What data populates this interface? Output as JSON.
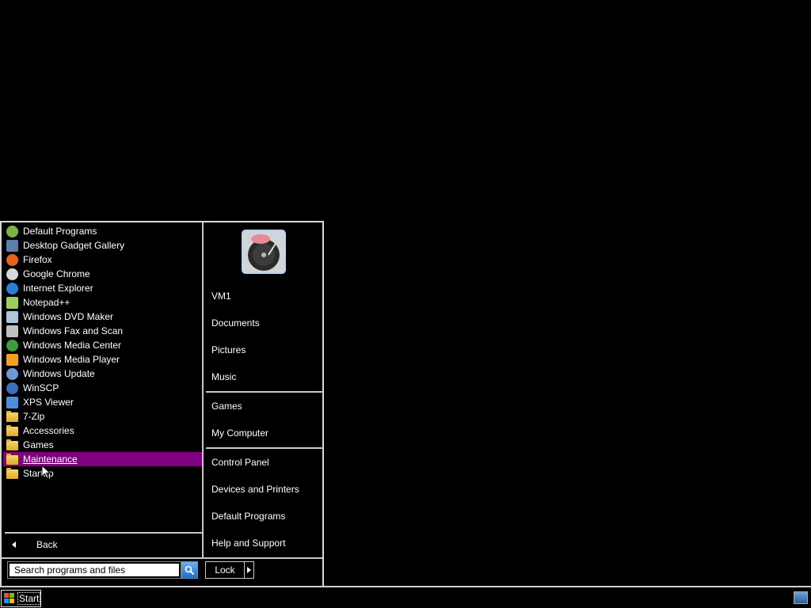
{
  "start_menu": {
    "programs": [
      {
        "label": "Default Programs",
        "icon": "default-programs-icon",
        "color": "#7cb342"
      },
      {
        "label": "Desktop Gadget Gallery",
        "icon": "gadget-gallery-icon",
        "color": "#5b7fa8"
      },
      {
        "label": "Firefox",
        "icon": "firefox-icon",
        "color": "#e8641c"
      },
      {
        "label": "Google Chrome",
        "icon": "chrome-icon",
        "color": "#d8d8d8"
      },
      {
        "label": "Internet Explorer",
        "icon": "internet-explorer-icon",
        "color": "#2a7fd4"
      },
      {
        "label": "Notepad++",
        "icon": "notepadpp-icon",
        "color": "#9fcf5a"
      },
      {
        "label": "Windows DVD Maker",
        "icon": "dvd-maker-icon",
        "color": "#b0c4de"
      },
      {
        "label": "Windows Fax and Scan",
        "icon": "fax-scan-icon",
        "color": "#c0c0c0"
      },
      {
        "label": "Windows Media Center",
        "icon": "media-center-icon",
        "color": "#3e9b3e"
      },
      {
        "label": "Windows Media Player",
        "icon": "media-player-icon",
        "color": "#f0a020"
      },
      {
        "label": "Windows Update",
        "icon": "windows-update-icon",
        "color": "#6a9ad8"
      },
      {
        "label": "WinSCP",
        "icon": "winscp-icon",
        "color": "#3b6fb8"
      },
      {
        "label": "XPS Viewer",
        "icon": "xps-viewer-icon",
        "color": "#4a90d9"
      },
      {
        "label": "7-Zip",
        "icon": "folder-icon",
        "color": "#e7b533"
      },
      {
        "label": "Accessories",
        "icon": "folder-icon",
        "color": "#e7b533"
      },
      {
        "label": "Games",
        "icon": "folder-icon",
        "color": "#e7b533"
      },
      {
        "label": "Maintenance",
        "icon": "folder-icon",
        "color": "#e7b533",
        "selected": true
      },
      {
        "label": "Startup",
        "icon": "folder-icon",
        "color": "#e7b533"
      }
    ],
    "back_label": "Back",
    "search": {
      "placeholder": "Search programs and files",
      "value": ""
    },
    "lock_label": "Lock",
    "right_items": {
      "user": "VM1",
      "documents": "Documents",
      "pictures": "Pictures",
      "music": "Music",
      "games": "Games",
      "my_computer": "My Computer",
      "control_panel": "Control Panel",
      "devices_printers": "Devices and Printers",
      "default_programs": "Default Programs",
      "help_support": "Help and Support"
    }
  },
  "taskbar": {
    "start_label": "Start"
  },
  "colors": {
    "selection": "#800080",
    "background": "#000000",
    "text": "#ffffff",
    "border": "#c8c8c8"
  }
}
